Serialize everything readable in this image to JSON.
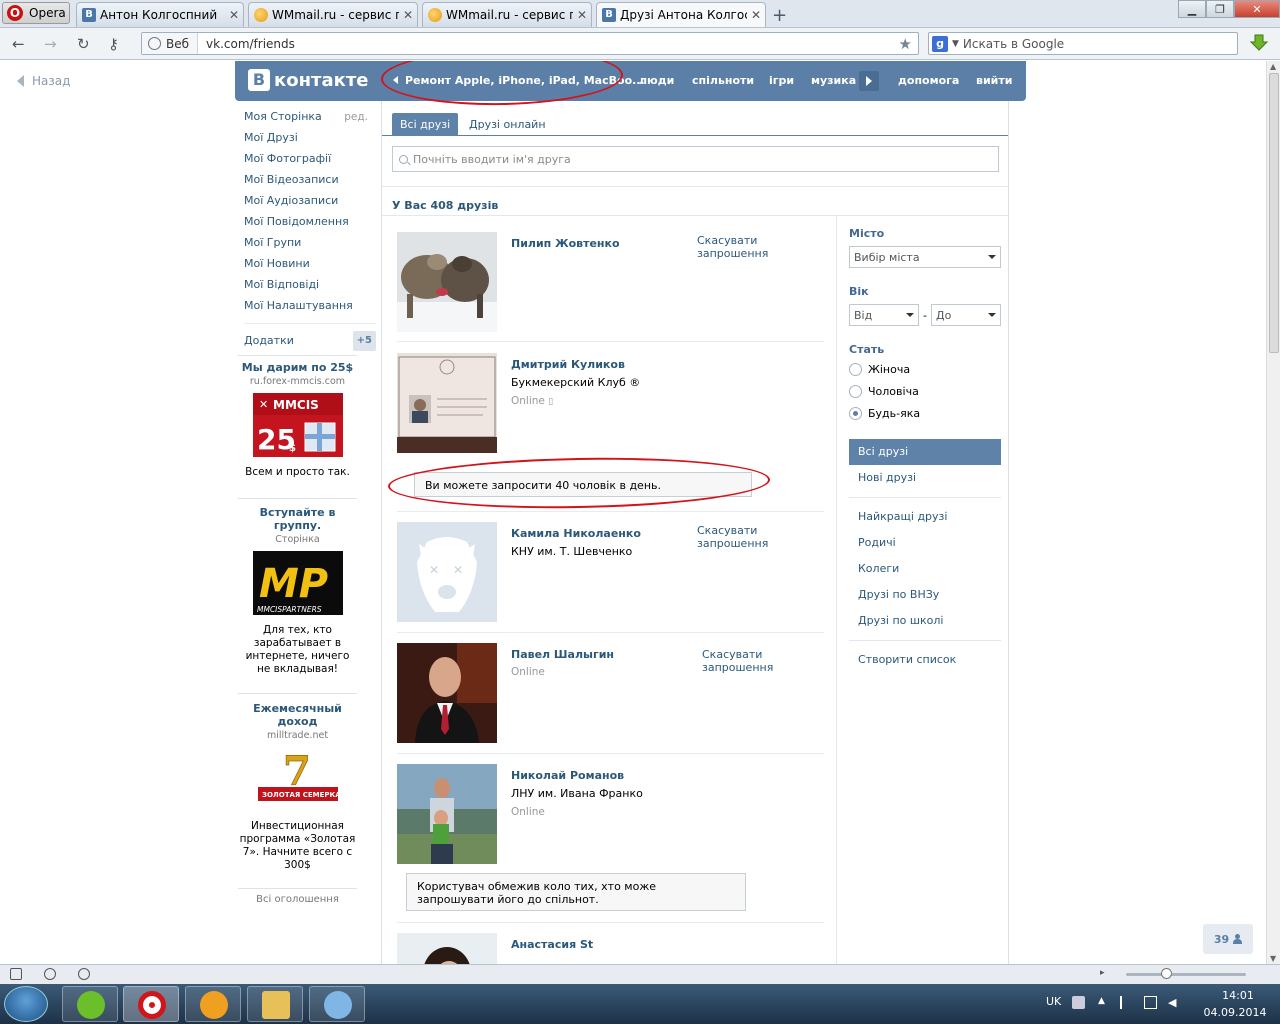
{
  "browser": {
    "menu_label": "Opera",
    "tabs": [
      {
        "title": "Антон Колгоспний",
        "favicon": "vk-icon"
      },
      {
        "title": "WMmail.ru - сервис п...",
        "favicon": "wmmail-icon"
      },
      {
        "title": "WMmail.ru - сервис п...",
        "favicon": "wmmail-icon"
      },
      {
        "title": "Друзі Антона Колгосп...",
        "favicon": "vk-icon"
      }
    ],
    "addr_web_label": "Веб",
    "url": "vk.com/friends",
    "search_placeholder": "Искать в Google"
  },
  "page": {
    "back_label": "Назад",
    "header": {
      "logo_text": "контакте",
      "logo_letter": "В",
      "ad_text": "Ремонт Apple, iPhone, iPad, MacBoo...",
      "menu": [
        "люди",
        "спільноти",
        "ігри",
        "музика",
        "допомога",
        "вийти"
      ]
    },
    "left_menu": {
      "items": [
        "Моя Сторінка",
        "Мої Друзі",
        "Мої Фотографії",
        "Мої Відеозаписи",
        "Мої Аудіозаписи",
        "Мої Повідомлення",
        "Мої Групи",
        "Мої Новини",
        "Мої Відповіді",
        "Мої Налаштування"
      ],
      "edit_label": "ред.",
      "apps_label": "Додатки",
      "apps_badge": "+5"
    },
    "ads": [
      {
        "title": "Мы дарим по 25$",
        "domain": "ru.forex-mmcis.com",
        "text": "Всем и просто так.",
        "img_brand": "MMCIS",
        "img_number": "25",
        "img_currency": "$"
      },
      {
        "title": "Вступайте в группу.",
        "domain": "Сторінка",
        "text": "Для тех, кто зарабатывает в интернете, ничего не вкладывая!",
        "img_brand": "MMCISPARTNERS",
        "img_letters": "MP"
      },
      {
        "title": "Ежемесячный доход",
        "domain": "milltrade.net",
        "text": "Инвестиционная программа «Золотая 7». Начните всего с 300$",
        "img_number": "7",
        "img_label": "ЗОЛОТАЯ СЕМЕРКА"
      }
    ],
    "all_ads_label": "Всі оголошення",
    "friends": {
      "tab_all": "Всі друзі",
      "tab_online": "Друзі онлайн",
      "search_placeholder": "Почніть вводити ім'я друга",
      "count_text": "У Вас 408 друзів",
      "list": [
        {
          "name": "Пилип Жовтенко",
          "sub": "",
          "online": "",
          "action": "Скасувати запрошення"
        },
        {
          "name": "Дмитрий Куликов",
          "sub": "Букмекерский Клуб ®",
          "online": "Online",
          "action": ""
        },
        {
          "name": "Камила Николаенко",
          "sub": "КНУ им. Т. Шевченко",
          "online": "",
          "action": "Скасувати запрошення"
        },
        {
          "name": "Павел Шалыгин",
          "sub": "",
          "online": "Online",
          "action": "Скасувати запрошення"
        },
        {
          "name": "Николай Романов",
          "sub": "ЛНУ им. Ивана Франко",
          "online": "Online",
          "action": ""
        },
        {
          "name": "Анастасия St",
          "sub": "",
          "online": "",
          "action": ""
        }
      ],
      "notice_invite_limit": "Ви можете запросити 40 чоловік в день.",
      "notice_restricted": "Користувач обмежив коло тих, хто може запрошувати його до спільнот."
    },
    "filters": {
      "city_label": "Місто",
      "city_select": "Вибір міста",
      "age_label": "Вік",
      "age_from": "Від",
      "age_dash": "-",
      "age_to": "До",
      "gender_label": "Стать",
      "gender_options": [
        "Жіноча",
        "Чоловіча",
        "Будь-яка"
      ],
      "gender_selected": "Будь-яка",
      "lists": [
        "Всі друзі",
        "Нові друзі",
        "Найкращі друзі",
        "Родичі",
        "Колеги",
        "Друзі по ВНЗу",
        "Друзі по школі",
        "Створити список"
      ]
    },
    "counter_badge": "39"
  },
  "taskbar": {
    "lang": "UK",
    "time": "14:01",
    "date": "04.09.2014"
  },
  "colors": {
    "vk_header": "#5b7fa6",
    "vk_link": "#2b587a",
    "annotation_red": "#d3131b"
  }
}
